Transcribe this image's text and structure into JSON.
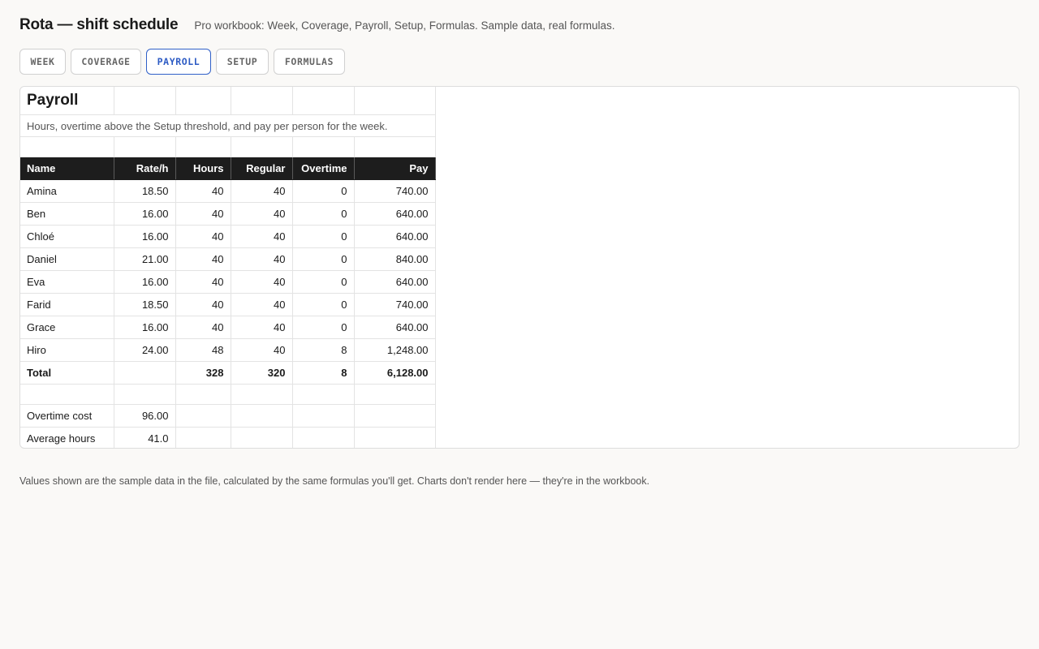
{
  "header": {
    "title": "Rota — shift schedule",
    "subtitle": "Pro workbook: Week, Coverage, Payroll, Setup, Formulas. Sample data, real formulas."
  },
  "tabs": [
    {
      "label": "WEEK",
      "active": false
    },
    {
      "label": "COVERAGE",
      "active": false
    },
    {
      "label": "PAYROLL",
      "active": true
    },
    {
      "label": "SETUP",
      "active": false
    },
    {
      "label": "FORMULAS",
      "active": false
    }
  ],
  "sheet": {
    "title": "Payroll",
    "description": "Hours, overtime above the Setup threshold, and pay per person for the week.",
    "columns": [
      "Name",
      "Rate/h",
      "Hours",
      "Regular",
      "Overtime",
      "Pay"
    ],
    "rows": [
      [
        "Amina",
        "18.50",
        "40",
        "40",
        "0",
        "740.00"
      ],
      [
        "Ben",
        "16.00",
        "40",
        "40",
        "0",
        "640.00"
      ],
      [
        "Chloé",
        "16.00",
        "40",
        "40",
        "0",
        "640.00"
      ],
      [
        "Daniel",
        "21.00",
        "40",
        "40",
        "0",
        "840.00"
      ],
      [
        "Eva",
        "16.00",
        "40",
        "40",
        "0",
        "640.00"
      ],
      [
        "Farid",
        "18.50",
        "40",
        "40",
        "0",
        "740.00"
      ],
      [
        "Grace",
        "16.00",
        "40",
        "40",
        "0",
        "640.00"
      ],
      [
        "Hiro",
        "24.00",
        "48",
        "40",
        "8",
        "1,248.00"
      ]
    ],
    "total": {
      "label": "Total",
      "rate": "",
      "hours": "328",
      "regular": "320",
      "overtime": "8",
      "pay": "6,128.00"
    },
    "summary": [
      {
        "label": "Overtime cost",
        "value": "96.00"
      },
      {
        "label": "Average hours",
        "value": "41.0"
      }
    ]
  },
  "footnote": "Values shown are the sample data in the file, calculated by the same formulas you'll get. Charts don't render here — they're in the workbook."
}
